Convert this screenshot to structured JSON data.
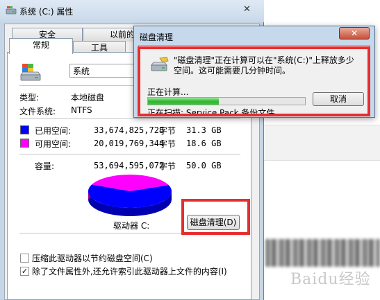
{
  "properties_window": {
    "title": "系统 (C:) 属性",
    "close_glyph": "✕",
    "tabs_top": [
      "安全",
      "以前的"
    ],
    "tabs_bottom": [
      "常规",
      "工具"
    ],
    "active_tab": "常规",
    "drive_name": "系统",
    "type_label": "类型:",
    "type_value": "本地磁盘",
    "fs_label": "文件系统:",
    "fs_value": "NTFS",
    "used": {
      "label": "已用空间:",
      "bytes": "33,674,825,728",
      "unit": "字节",
      "size": "31.3 GB",
      "color": "#0000ff"
    },
    "free": {
      "label": "可用空间:",
      "bytes": "20,019,769,344",
      "unit": "字节",
      "size": "18.6 GB",
      "color": "#ff00ff"
    },
    "capacity": {
      "label": "容量:",
      "bytes": "53,694,595,072",
      "unit": "字节",
      "size": "50.0 GB"
    },
    "used_fraction": 0.626,
    "drive_label": "驱动器 C:",
    "cleanup_button": "磁盘清理(D)",
    "compress_option": {
      "label": "压缩此驱动器以节约磁盘空间(C)",
      "checked": false
    },
    "index_option": {
      "label": "除了文件属性外,还允许索引此驱动器上文件的内容(I)",
      "checked": true
    }
  },
  "cleanup_dialog": {
    "title": "磁盘清理",
    "close_glyph": "✕",
    "message_line1": "\"磁盘清理\"正在计算可以在\"系统(C:)\"上释放多少",
    "message_line2": "空间。这可能需要几分钟时间。",
    "status": "正在计算...",
    "progress": 0.45,
    "cancel_button": "取消",
    "scan_line": "正在扫描: Service Pack 备份文件"
  },
  "watermark": "Baidu经验",
  "icons": {
    "drive": "hard-drive-icon",
    "cleanup": "disk-cleanup-icon",
    "title": "drive-title-icon"
  },
  "colors": {
    "highlight": "#e62e2e",
    "progress": "#2fb52f"
  }
}
